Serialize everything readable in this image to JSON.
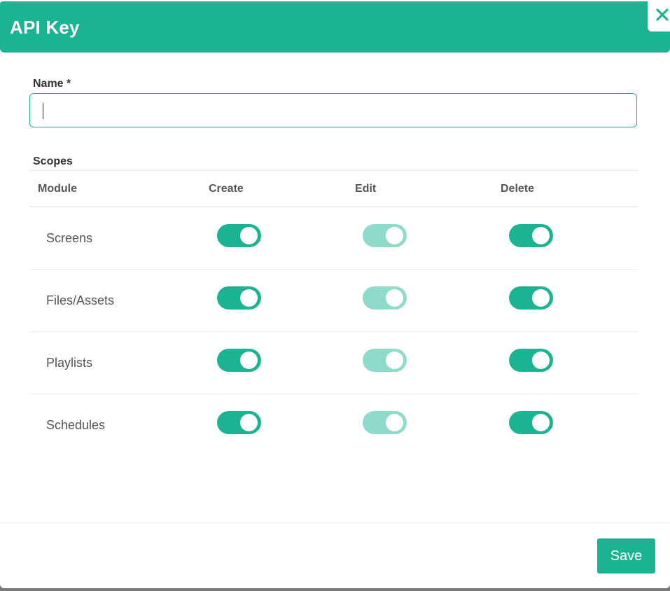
{
  "dialog": {
    "title": "API Key",
    "close_icon": "close-icon"
  },
  "form": {
    "name_label": "Name *",
    "name_value": "",
    "scopes_label": "Scopes"
  },
  "scopes_table": {
    "columns": [
      "Module",
      "Create",
      "Edit",
      "Delete"
    ],
    "rows": [
      {
        "module": "Screens",
        "create": true,
        "edit": true,
        "delete": true,
        "edit_disabled": true
      },
      {
        "module": "Files/Assets",
        "create": true,
        "edit": true,
        "delete": true,
        "edit_disabled": true
      },
      {
        "module": "Playlists",
        "create": true,
        "edit": true,
        "delete": true,
        "edit_disabled": true
      },
      {
        "module": "Schedules",
        "create": true,
        "edit": true,
        "delete": true,
        "edit_disabled": true
      }
    ]
  },
  "footer": {
    "save_label": "Save"
  },
  "colors": {
    "accent": "#1bb391",
    "toggle_disabled": "#8fdbc9"
  }
}
